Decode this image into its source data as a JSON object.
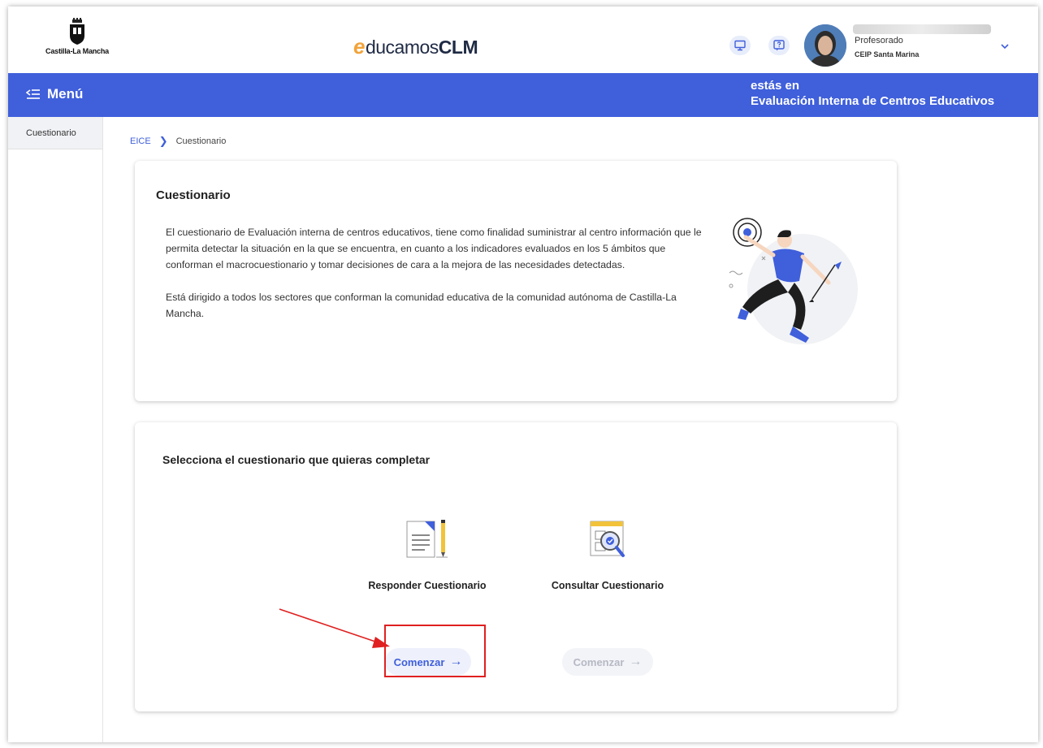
{
  "header": {
    "region_name": "Castilla-La Mancha",
    "brand_e": "e",
    "brand_mid": "ducamos",
    "brand_end": "CLM",
    "user": {
      "role": "Profesorado",
      "center": "CEIP Santa Marina"
    },
    "icons": [
      "monitor-icon",
      "help-icon",
      "chevron-down-icon"
    ]
  },
  "bluebar": {
    "menu_label": "Menú",
    "location_prefix": "estás en",
    "location_name": "Evaluación Interna de Centros Educativos"
  },
  "sidebar": {
    "items": [
      {
        "label": "Cuestionario"
      }
    ]
  },
  "breadcrumb": {
    "root": "EICE",
    "current": "Cuestionario"
  },
  "intro": {
    "title": "Cuestionario",
    "paragraphs": [
      "El cuestionario de Evaluación interna de centros educativos, tiene como finalidad suministrar al centro información que le permita detectar la situación en la que se encuentra, en cuanto a los indicadores evaluados en los 5 ámbitos que conforman el macrocuestionario y tomar decisiones de cara a la mejora de las necesidades detectadas.",
      "Está dirigido a todos los sectores que conforman la comunidad educativa de la comunidad autónoma de Castilla-La Mancha."
    ]
  },
  "selector": {
    "title": "Selecciona el cuestionario que quieras completar",
    "options": [
      {
        "label": "Responder Cuestionario",
        "button": "Comenzar",
        "enabled": true
      },
      {
        "label": "Consultar Cuestionario",
        "button": "Comenzar",
        "enabled": false
      }
    ]
  },
  "colors": {
    "primary": "#3f5fdb",
    "brand_orange": "#f2a33a",
    "annotation_red": "#e02020"
  }
}
